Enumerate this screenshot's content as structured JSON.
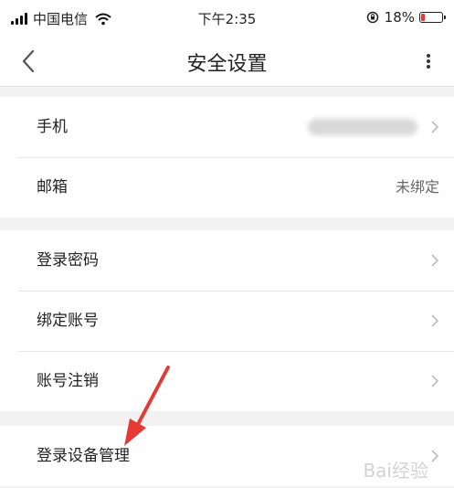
{
  "status_bar": {
    "carrier": "中国电信",
    "time": "下午2:35",
    "battery": "18%",
    "battery_level": 0.18
  },
  "nav": {
    "title": "安全设置",
    "back_icon": "chevron-left-icon",
    "more_icon": "more-vertical-icon"
  },
  "groups": {
    "account": [
      {
        "label": "手机",
        "value": ""
      },
      {
        "label": "邮箱",
        "value": "未绑定"
      }
    ],
    "security": [
      {
        "label": "登录密码"
      },
      {
        "label": "绑定账号"
      },
      {
        "label": "账号注销"
      }
    ],
    "devices": [
      {
        "label": "登录设备管理"
      }
    ]
  },
  "colors": {
    "annotation_arrow": "#e53935",
    "battery_low": "#e53935"
  },
  "watermark": "Bai经验"
}
